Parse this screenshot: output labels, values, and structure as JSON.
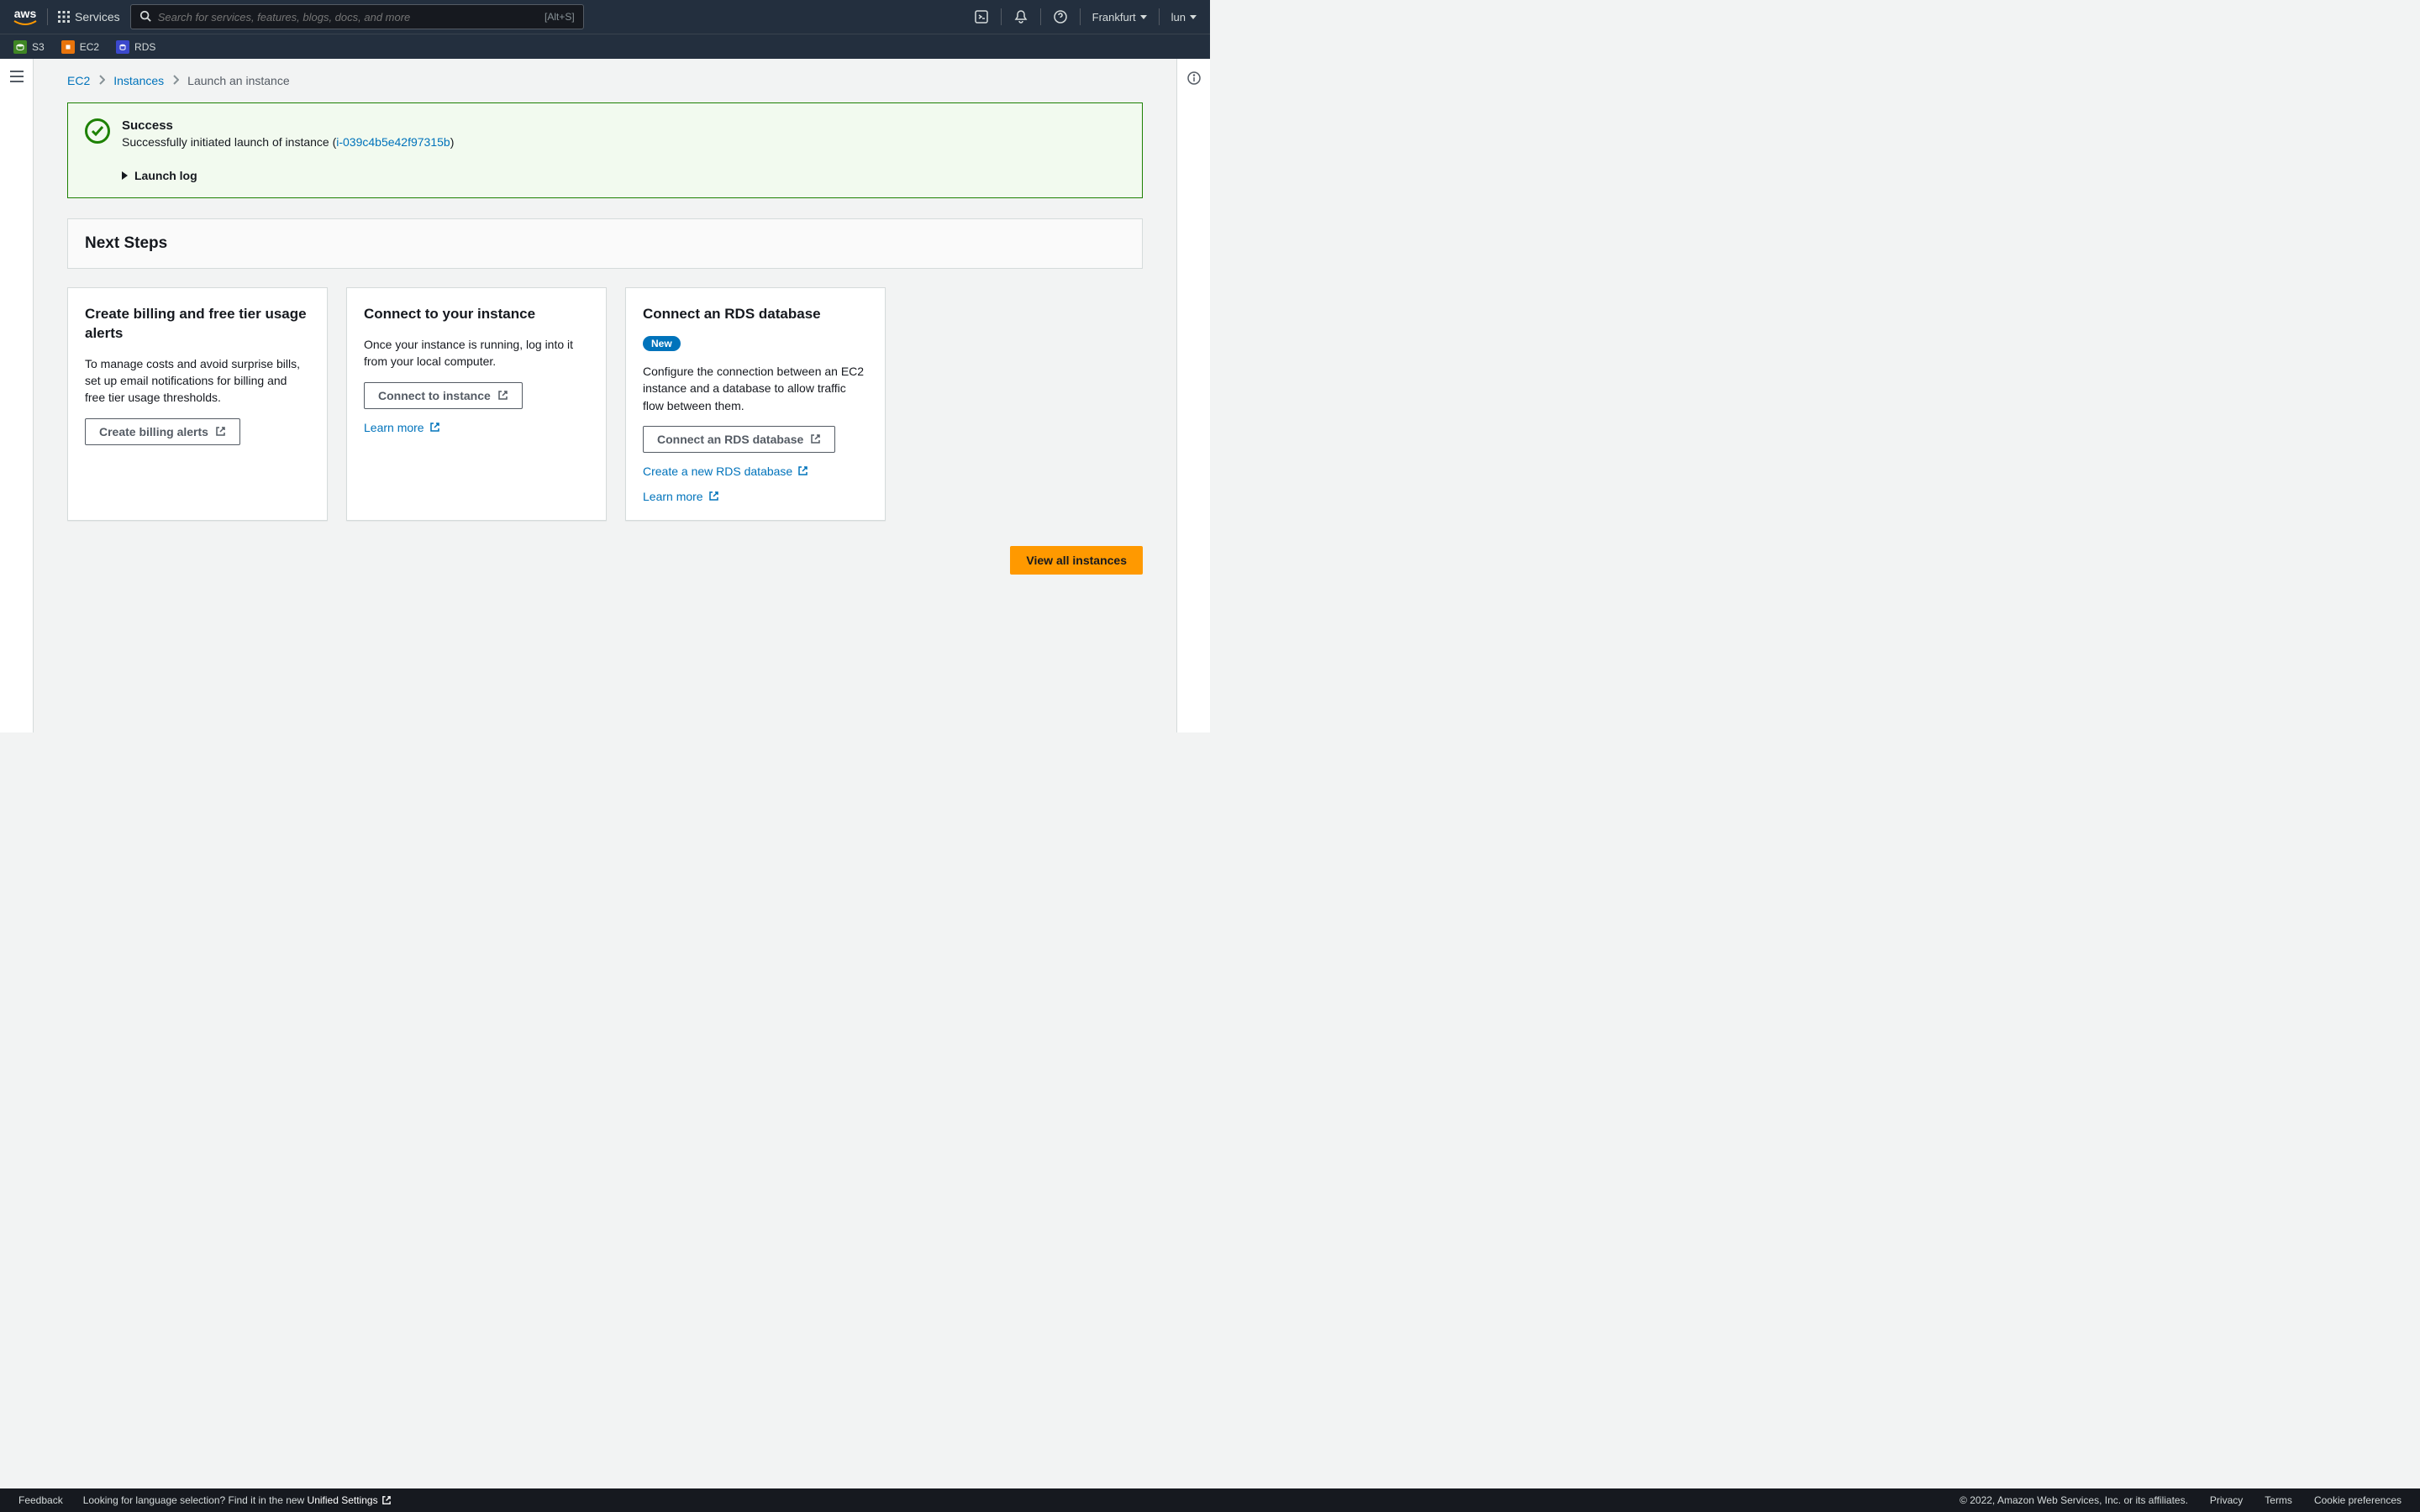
{
  "top": {
    "services_label": "Services",
    "search_placeholder": "Search for services, features, blogs, docs, and more",
    "search_kbd": "[Alt+S]",
    "region": "Frankfurt",
    "user": "lun"
  },
  "service_bar": {
    "s3": "S3",
    "ec2": "EC2",
    "rds": "RDS"
  },
  "breadcrumb": {
    "root": "EC2",
    "mid": "Instances",
    "current": "Launch an instance"
  },
  "success": {
    "title": "Success",
    "msg_prefix": "Successfully initiated launch of instance (",
    "instance_id": "i-039c4b5e42f97315b",
    "msg_suffix": ")",
    "launch_log": "Launch log"
  },
  "next_steps_title": "Next Steps",
  "cards": {
    "billing": {
      "title": "Create billing and free tier usage alerts",
      "body": "To manage costs and avoid surprise bills, set up email notifications for billing and free tier usage thresholds.",
      "button": "Create billing alerts"
    },
    "connect": {
      "title": "Connect to your instance",
      "body": "Once your instance is running, log into it from your local computer.",
      "button": "Connect to instance",
      "link": "Learn more"
    },
    "rds": {
      "title": "Connect an RDS database",
      "badge": "New",
      "body": "Configure the connection between an EC2 instance and a database to allow traffic flow between them.",
      "button": "Connect an RDS database",
      "link1": "Create a new RDS database",
      "link2": "Learn more"
    }
  },
  "view_all": "View all instances",
  "footer": {
    "feedback": "Feedback",
    "lang_prompt": "Looking for language selection? Find it in the new ",
    "unified": "Unified Settings",
    "copyright": "© 2022, Amazon Web Services, Inc. or its affiliates.",
    "privacy": "Privacy",
    "terms": "Terms",
    "cookie": "Cookie preferences"
  }
}
